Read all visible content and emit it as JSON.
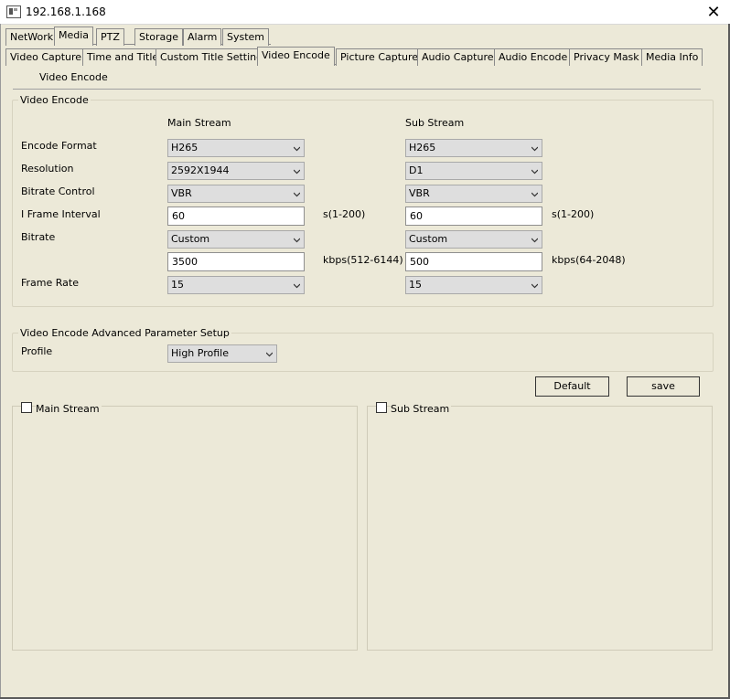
{
  "window": {
    "title": "192.168.1.168",
    "close_symbol": "✕"
  },
  "main_tabs": [
    {
      "label": "NetWork"
    },
    {
      "label": "Media"
    },
    {
      "label": "PTZ"
    },
    {
      "label": "Storage"
    },
    {
      "label": "Alarm"
    },
    {
      "label": "System"
    }
  ],
  "main_tab_active": "Media",
  "sub_tabs": [
    {
      "label": "Video Capture"
    },
    {
      "label": "Time and Title"
    },
    {
      "label": "Custom Title Settings"
    },
    {
      "label": "Video Encode"
    },
    {
      "label": "Picture Capture"
    },
    {
      "label": "Audio Capture"
    },
    {
      "label": "Audio Encode"
    },
    {
      "label": "Privacy Mask"
    },
    {
      "label": "Media Info"
    }
  ],
  "sub_tab_active": "Video Encode",
  "section_title": "Video Encode",
  "encode_group": {
    "title": "Video Encode",
    "col_main": "Main Stream",
    "col_sub": "Sub Stream",
    "labels": {
      "encode_format": "Encode Format",
      "resolution": "Resolution",
      "bitrate_control": "Bitrate Control",
      "i_frame_interval": "I Frame Interval",
      "bitrate": "Bitrate",
      "frame_rate": "Frame Rate"
    },
    "main": {
      "encode_format": "H265",
      "resolution": "2592X1944",
      "bitrate_control": "VBR",
      "i_frame_interval": "60",
      "i_frame_unit": "s(1-200)",
      "bitrate_mode": "Custom",
      "bitrate_value": "3500",
      "bitrate_unit": "kbps(512-6144)",
      "frame_rate": "15"
    },
    "sub": {
      "encode_format": "H265",
      "resolution": "D1",
      "bitrate_control": "VBR",
      "i_frame_interval": "60",
      "i_frame_unit": "s(1-200)",
      "bitrate_mode": "Custom",
      "bitrate_value": "500",
      "bitrate_unit": "kbps(64-2048)",
      "frame_rate": "15"
    }
  },
  "advanced_group": {
    "title": "Video Encode Advanced Parameter Setup",
    "profile_label": "Profile",
    "profile_value": "High Profile"
  },
  "buttons": {
    "default": "Default",
    "save": "save"
  },
  "stream_panels": {
    "main_label": "Main Stream",
    "sub_label": "Sub Stream",
    "main_checked": false,
    "sub_checked": false
  }
}
